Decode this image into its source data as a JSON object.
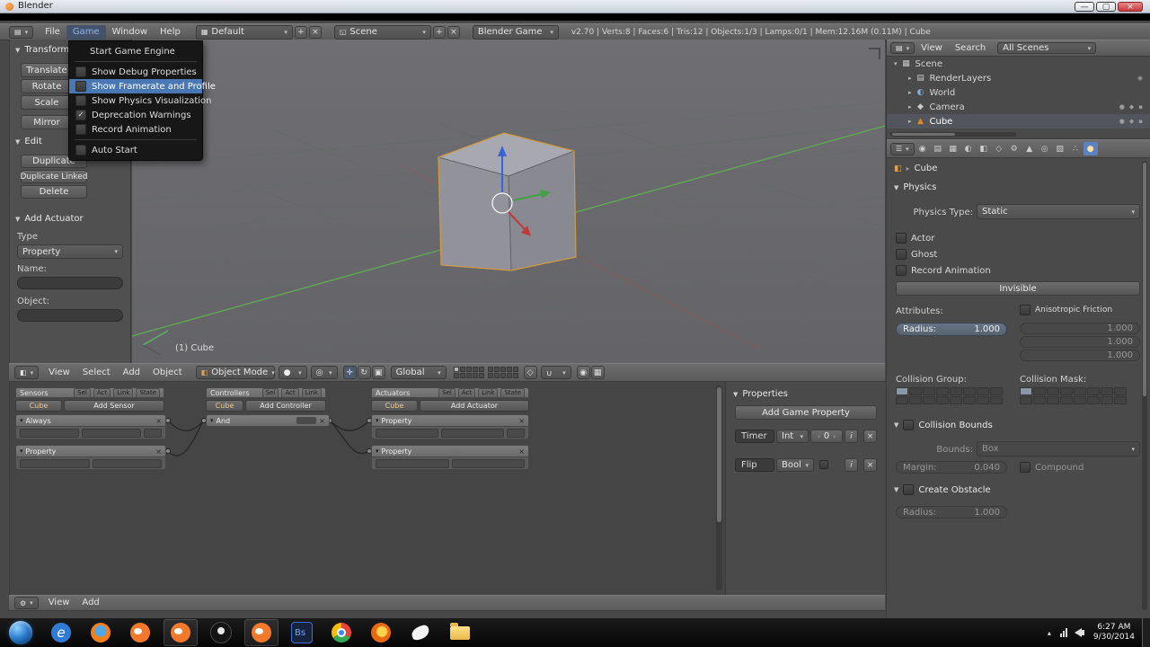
{
  "window": {
    "title": "Blender"
  },
  "info_bar": {
    "menus": [
      "File",
      "Game",
      "Window",
      "Help"
    ],
    "layout": "Default",
    "scene": "Scene",
    "engine": "Blender Game",
    "stats": "v2.70 | Verts:8 | Faces:6 | Tris:12 | Objects:1/3 | Lamps:0/1 | Mem:12.16M (0.11M) | Cube"
  },
  "game_menu": {
    "items": [
      {
        "label": "Start Game Engine",
        "type": "plain",
        "checked": false,
        "highlighted": false
      },
      {
        "label": "Show Debug Properties",
        "type": "checkbox",
        "checked": false,
        "highlighted": false
      },
      {
        "label": "Show Framerate and Profile",
        "type": "checkbox",
        "checked": false,
        "highlighted": true
      },
      {
        "label": "Show Physics Visualization",
        "type": "checkbox",
        "checked": false,
        "highlighted": false
      },
      {
        "label": "Deprecation Warnings",
        "type": "checkbox",
        "checked": true,
        "highlighted": false
      },
      {
        "label": "Record Animation",
        "type": "checkbox",
        "checked": false,
        "highlighted": false
      },
      {
        "label": "Auto Start",
        "type": "checkbox",
        "checked": false,
        "highlighted": false
      }
    ]
  },
  "tool_shelf": {
    "transform_title": "Transform",
    "buttons": [
      "Translate",
      "Rotate",
      "Scale",
      "Mirror"
    ],
    "edit_title": "Edit",
    "edit_buttons": [
      "Duplicate",
      "Duplicate Linked",
      "Delete"
    ],
    "actuator_title": "Add Actuator",
    "type_label": "Type",
    "type_value": "Property",
    "name_label": "Name:",
    "object_label": "Object:"
  },
  "viewport": {
    "object_label": "(1) Cube"
  },
  "viewport_header": {
    "menus": [
      "View",
      "Select",
      "Add",
      "Object"
    ],
    "mode": "Object Mode",
    "orientation": "Global"
  },
  "logic_editor": {
    "columns": [
      {
        "title": "Sensors",
        "object": "Cube",
        "add_button": "Add Sensor",
        "toggles": [
          "Sel",
          "Act",
          "Link",
          "State"
        ]
      },
      {
        "title": "Controllers",
        "object": "Cube",
        "add_button": "Add Controller",
        "toggles": [
          "Sel",
          "Act",
          "Link"
        ]
      },
      {
        "title": "Actuators",
        "object": "Cube",
        "add_button": "Add Actuator",
        "toggles": [
          "Sel",
          "Act",
          "Link",
          "State"
        ]
      }
    ],
    "sensors": [
      {
        "name": "Always"
      },
      {
        "name": "Property"
      }
    ],
    "controllers": [
      {
        "name": "And"
      }
    ],
    "actuators": [
      {
        "name": "Property"
      },
      {
        "name": "Property"
      }
    ],
    "header_menus": [
      "View",
      "Add"
    ],
    "properties": {
      "title": "Properties",
      "add_button": "Add Game Property",
      "rows": [
        {
          "name": "Timer",
          "type": "Int",
          "value": "0"
        },
        {
          "name": "Flip",
          "type": "Bool",
          "value": ""
        }
      ]
    }
  },
  "outliner": {
    "menus": [
      "View",
      "Search"
    ],
    "filter": "All Scenes",
    "items": [
      {
        "label": "Scene"
      },
      {
        "label": "RenderLayers"
      },
      {
        "label": "World"
      },
      {
        "label": "Camera"
      },
      {
        "label": "Cube"
      }
    ]
  },
  "properties_editor": {
    "context": "Cube",
    "physics": {
      "title": "Physics",
      "type_label": "Physics Type:",
      "type_value": "Static",
      "checkboxes": [
        "Actor",
        "Ghost",
        "Record Animation"
      ],
      "invisible_button": "Invisible",
      "attributes_label": "Attributes:",
      "radius_label": "Radius:",
      "radius_value": "1.000",
      "aniso_label": "Anisotropic Friction",
      "friction_values": [
        "1.000",
        "1.000",
        "1.000"
      ],
      "collision_group_label": "Collision Group:",
      "collision_mask_label": "Collision Mask:"
    },
    "collision_bounds": {
      "title": "Collision Bounds",
      "bounds_label": "Bounds:",
      "bounds_value": "Box",
      "margin_label": "Margin:",
      "margin_value": "0.040",
      "compound_label": "Compound"
    },
    "create_obstacle": {
      "title": "Create Obstacle",
      "radius_label": "Radius:",
      "radius_value": "1.000"
    }
  },
  "taskbar": {
    "time": "6:27 AM",
    "date": "9/30/2014",
    "icons": [
      "start-orb",
      "internet-explorer-icon",
      "firefox-icon",
      "blender-icon",
      "blender-icon",
      "billiard-ball-icon",
      "blender-icon",
      "photoshop-icon",
      "chrome-icon",
      "firefox-icon",
      "dove-icon",
      "folder-icon"
    ],
    "tray_icons": [
      "tray-expand-icon",
      "network-icon",
      "volume-icon"
    ]
  },
  "colors": {
    "accent_blue": "#4a78b5",
    "select_orange": "#d29a3f",
    "axis_green": "#5fae4f"
  }
}
